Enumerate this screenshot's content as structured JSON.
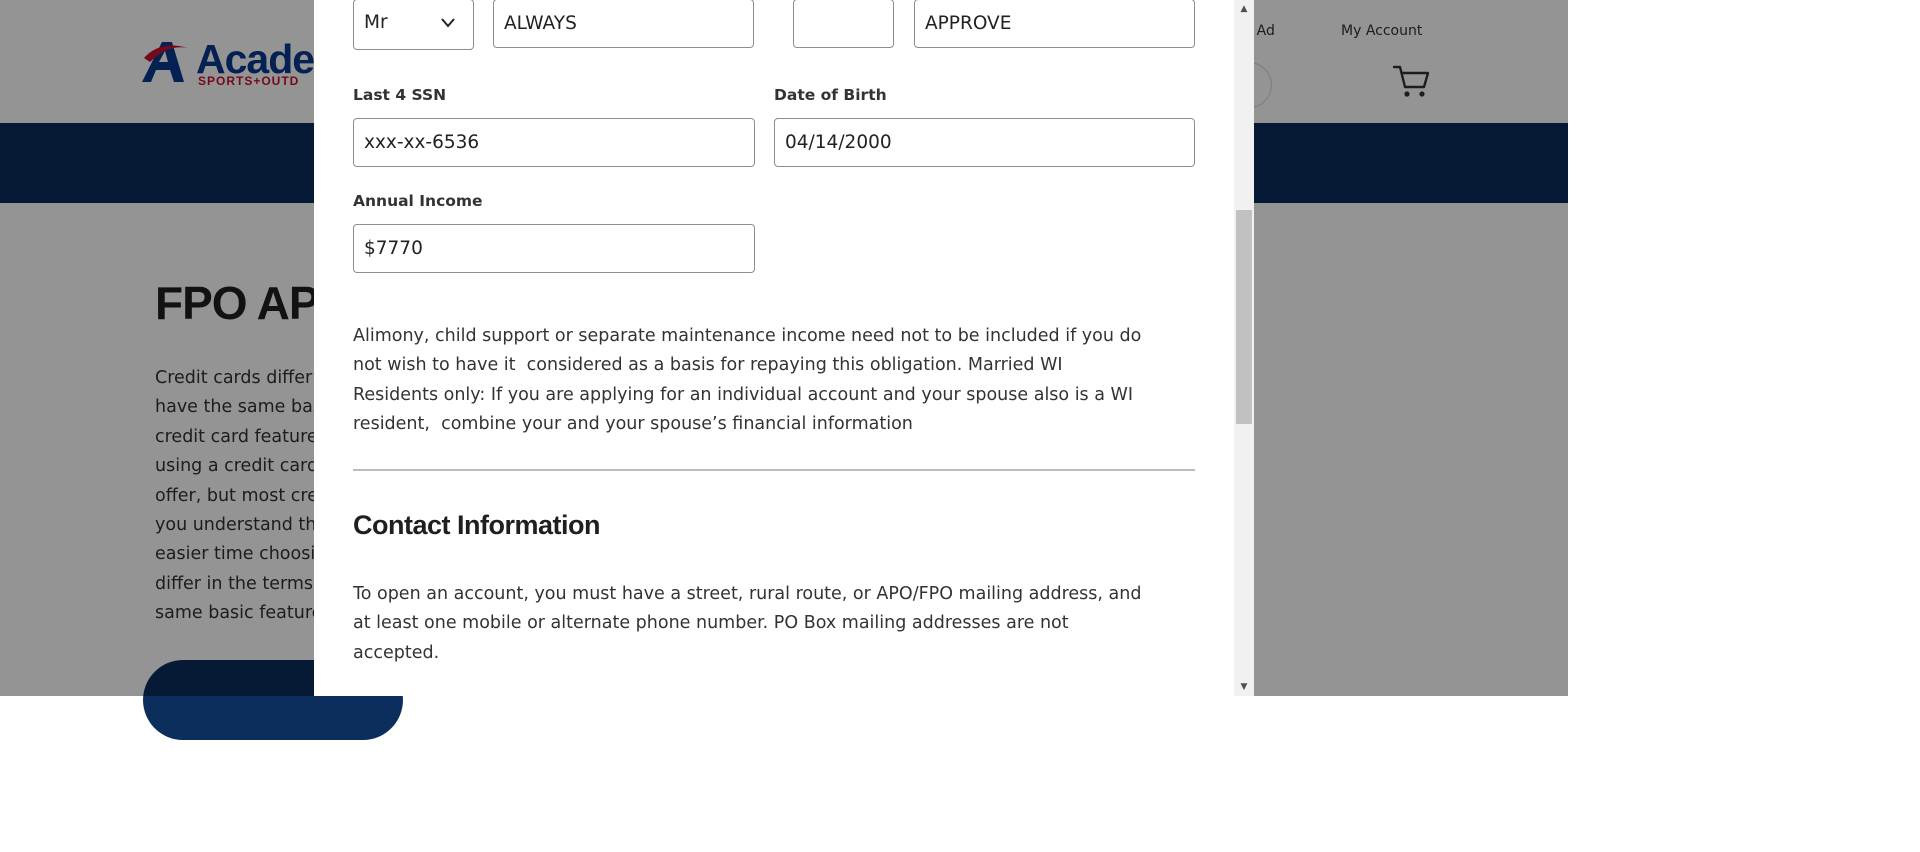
{
  "background_page": {
    "logo": {
      "word": "Acade",
      "tagline": "SPORTS+OUTD"
    },
    "top_links": {
      "weekly_ad": "ly Ad",
      "my_account": "My Account"
    },
    "hero_title": "FPO APP",
    "hero_text_lines": [
      "Credit cards differ",
      "have the same basic",
      "credit card features",
      "using a credit card",
      "offer, but most cre",
      "you understand the",
      "easier time choosi",
      "differ in the terms",
      "same basic features"
    ],
    "colors": {
      "nav_bar": "#0b2e5c",
      "logo_blue": "#0a3a8f",
      "logo_red": "#c8102e"
    }
  },
  "form": {
    "salutation": {
      "value": "Mr",
      "icon": "chevron-down-icon"
    },
    "first_name": {
      "value": "ALWAYS"
    },
    "middle_initial": {
      "value": ""
    },
    "last_name": {
      "value": "APPROVE"
    },
    "ssn": {
      "label": "Last 4 SSN",
      "value": "xxx-xx-6536"
    },
    "dob": {
      "label": "Date of Birth",
      "value": "04/14/2000"
    },
    "income": {
      "label": "Annual Income",
      "value": "$7770"
    }
  },
  "disclaimer_lines": [
    "Alimony, child support or separate maintenance income need not to be included if you do",
    "not wish to have it  considered as a basis for repaying this obligation. Married WI",
    "Residents only: If you are applying for an individual account and your spouse also is a WI",
    "resident,  combine your and your spouse’s financial information"
  ],
  "contact_section": {
    "heading": "Contact Information",
    "text_lines": [
      "To open an account, you must have a street, rural route, or APO/FPO mailing address, and",
      "at least one mobile or alternate phone number. PO Box mailing addresses are not",
      "accepted."
    ]
  },
  "scrollbar": {
    "up_arrow": "▲",
    "down_arrow": "▼"
  }
}
